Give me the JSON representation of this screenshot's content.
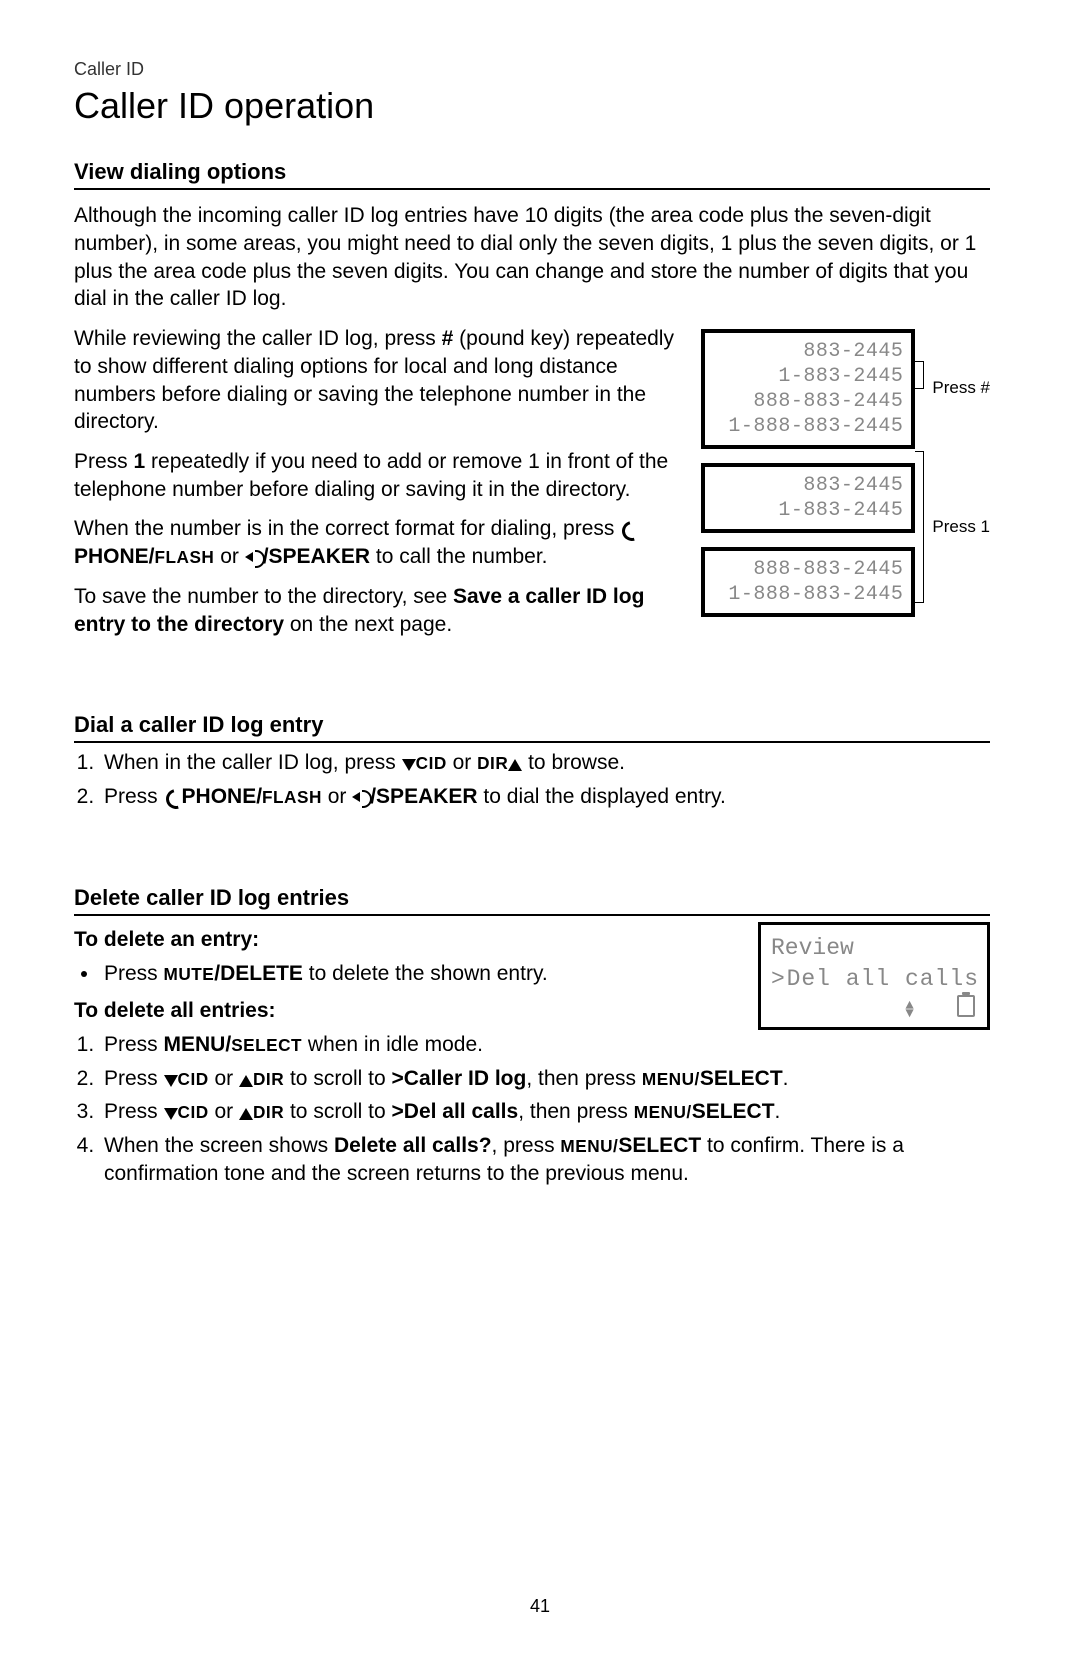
{
  "eyebrow": "Caller ID",
  "title": "Caller ID operation",
  "section1": {
    "heading": "View dialing options",
    "p1": "Although the incoming caller ID log entries have 10 digits (the area code plus the seven-digit number), in some areas, you might need to dial only the seven digits, 1 plus the seven digits, or 1 plus the area code plus the seven digits. You can change and store the number of digits that you dial in the caller ID log.",
    "p2a": "While reviewing the caller ID log, press ",
    "p2b": " (pound key) repeatedly to show different dialing options for local and long distance numbers before dialing or saving the telephone number in the directory.",
    "p3a": "Press ",
    "p3b": " repeatedly if you need to add or remove 1 in front of the telephone number before dialing or saving it in the directory.",
    "p4a": "When the number is in the correct format for dialing, press ",
    "p4_phone": "PHONE/",
    "p4_flash": "FLASH",
    "p4_or": " or ",
    "p4_speaker": "/SPEAKER",
    "p4b": " to call the number.",
    "p5a": "To save the number to the directory, see ",
    "p5_ref": "Save a caller ID log entry to the directory",
    "p5b": " on the next page.",
    "key_hash": "#",
    "key_one": "1",
    "label_hash": "Press #",
    "label_one": "Press 1",
    "screenA": [
      "883-2445",
      "1-883-2445",
      "888-883-2445",
      "1-888-883-2445"
    ],
    "screenB": [
      "883-2445",
      "1-883-2445"
    ],
    "screenC": [
      "888-883-2445",
      "1-888-883-2445"
    ]
  },
  "section2": {
    "heading": "Dial a caller ID log entry",
    "step1a": "When in the caller ID log, press ",
    "cid": "CID",
    "or": " or ",
    "dir": "DIR",
    "step1b": " to browse.",
    "step2a": "Press ",
    "phone": "PHONE/",
    "flash": "FLASH",
    "or2": " or ",
    "speaker": "/SPEAKER",
    "step2b": " to dial the displayed entry."
  },
  "section3": {
    "heading": "Delete caller ID log entries",
    "sub1": "To delete an entry:",
    "bul_a": "Press ",
    "mute": "MUTE",
    "delete": "/DELETE",
    "bul_b": " to delete the shown entry.",
    "sub2": "To delete all entries:",
    "s1a": "Press ",
    "menu": "MENU/",
    "select": "SELECT",
    "s1b": " when in idle mode.",
    "s2a": "Press ",
    "cid": "CID",
    "or": " or ",
    "dir": "DIR",
    "s2b": " to scroll to ",
    "s2_target": ">Caller ID log",
    "s2c": ", then press ",
    "s2d": ".",
    "s3a": "Press ",
    "s3b": " to scroll to ",
    "s3_target": ">Del all calls",
    "s3c": ", then press ",
    "s3d": ".",
    "s4a": "When the screen shows ",
    "s4_prompt": "Delete all calls?",
    "s4b": ", press ",
    "s4c": " to confirm. There is a confirmation tone and the screen returns to the previous menu.",
    "lcd": {
      "l1": "Review",
      "l2a": ">",
      "l2b": "Del all calls"
    }
  },
  "pagenum": "41"
}
